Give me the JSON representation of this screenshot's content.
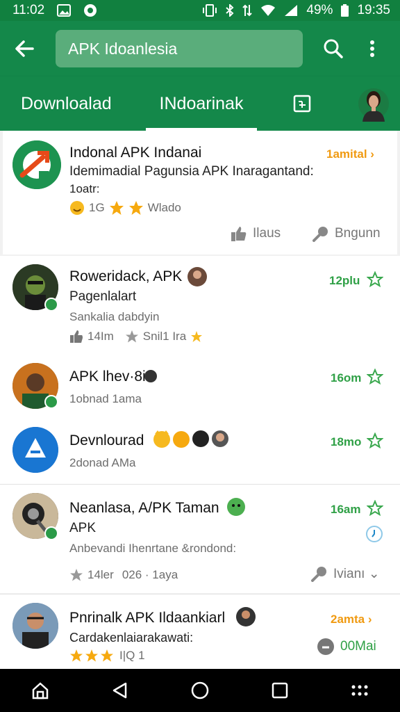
{
  "status_bar": {
    "time_left": "11:02",
    "battery": "49%",
    "clock": "19:35"
  },
  "app_bar": {
    "search_text": "APK Idoanlesia"
  },
  "tabs": {
    "download": "Downloalad",
    "active": "INdoarinak"
  },
  "colors": {
    "primary": "#14884a",
    "status": "#11803f",
    "accent_green": "#2fa046",
    "accent_orange": "#f09a11"
  },
  "featured": {
    "title": "Indonal APK Indanai",
    "description": "Idemimadial Pagunsia APK Inaragantand:",
    "extra": "1oatr:",
    "rating_text": "1G",
    "rating_label": "Wlado",
    "right_link": "1amital ›",
    "like_label": "Ilaus",
    "action_label": "Bngunn"
  },
  "items": [
    {
      "title": "Roweridack, APK",
      "title2": "Pagenlalart",
      "subtitle": "Sankalia dabdyin",
      "stat1": "14Im",
      "stat2": "Snil1 Ira",
      "right": "12plu"
    },
    {
      "title": "APK lhev·8i",
      "subtitle": "1obnad 1ama",
      "right": "16om"
    },
    {
      "title": "Devnlourad",
      "subtitle": "2donad AMa",
      "right": "18mo"
    },
    {
      "title": "Neanlasa, A/PK Taman",
      "title2": "APK",
      "subtitle": "Anbevandi Ihenrtane &rondond:",
      "stat1": "14ler",
      "stat2": "026 · 1aya",
      "right": "16am",
      "action": "Ivianı ⌄"
    },
    {
      "title": "Pnrinalk APK Ildaankiarl",
      "subtitle": "Cardakenlaiarakawati:",
      "stat": "I|Q 1",
      "right": "2amta ›",
      "action": "00Mai"
    }
  ]
}
